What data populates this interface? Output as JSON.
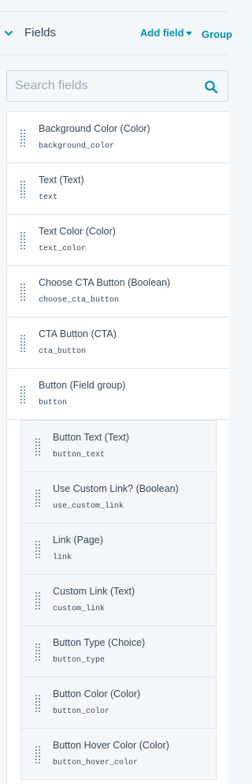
{
  "header": {
    "title": "Fields",
    "add_field_label": "Add field",
    "group_label": "Group"
  },
  "search": {
    "placeholder": "Search fields",
    "value": ""
  },
  "fields": [
    {
      "label": "Background Color (Color)",
      "name": "background_color"
    },
    {
      "label": "Text (Text)",
      "name": "text"
    },
    {
      "label": "Text Color (Color)",
      "name": "text_color"
    },
    {
      "label": "Choose CTA Button (Boolean)",
      "name": "choose_cta_button"
    },
    {
      "label": "CTA Button (CTA)",
      "name": "cta_button"
    },
    {
      "label": "Button (Field group)",
      "name": "button"
    }
  ],
  "group_fields": [
    {
      "label": "Button Text (Text)",
      "name": "button_text"
    },
    {
      "label": "Use Custom Link? (Boolean)",
      "name": "use_custom_link"
    },
    {
      "label": "Link (Page)",
      "name": "link"
    },
    {
      "label": "Custom Link (Text)",
      "name": "custom_link"
    },
    {
      "label": "Button Type (Choice)",
      "name": "button_type"
    },
    {
      "label": "Button Color (Color)",
      "name": "button_color"
    },
    {
      "label": "Button Hover Color (Color)",
      "name": "button_hover_color"
    }
  ],
  "colors": {
    "accent": "#0091ae",
    "text": "#33475b",
    "border": "#dfe3eb",
    "background": "#f5f8fa"
  },
  "icons": {
    "collapse": "chevron-down-icon",
    "search": "search-icon",
    "drag": "drag-handle-icon"
  }
}
